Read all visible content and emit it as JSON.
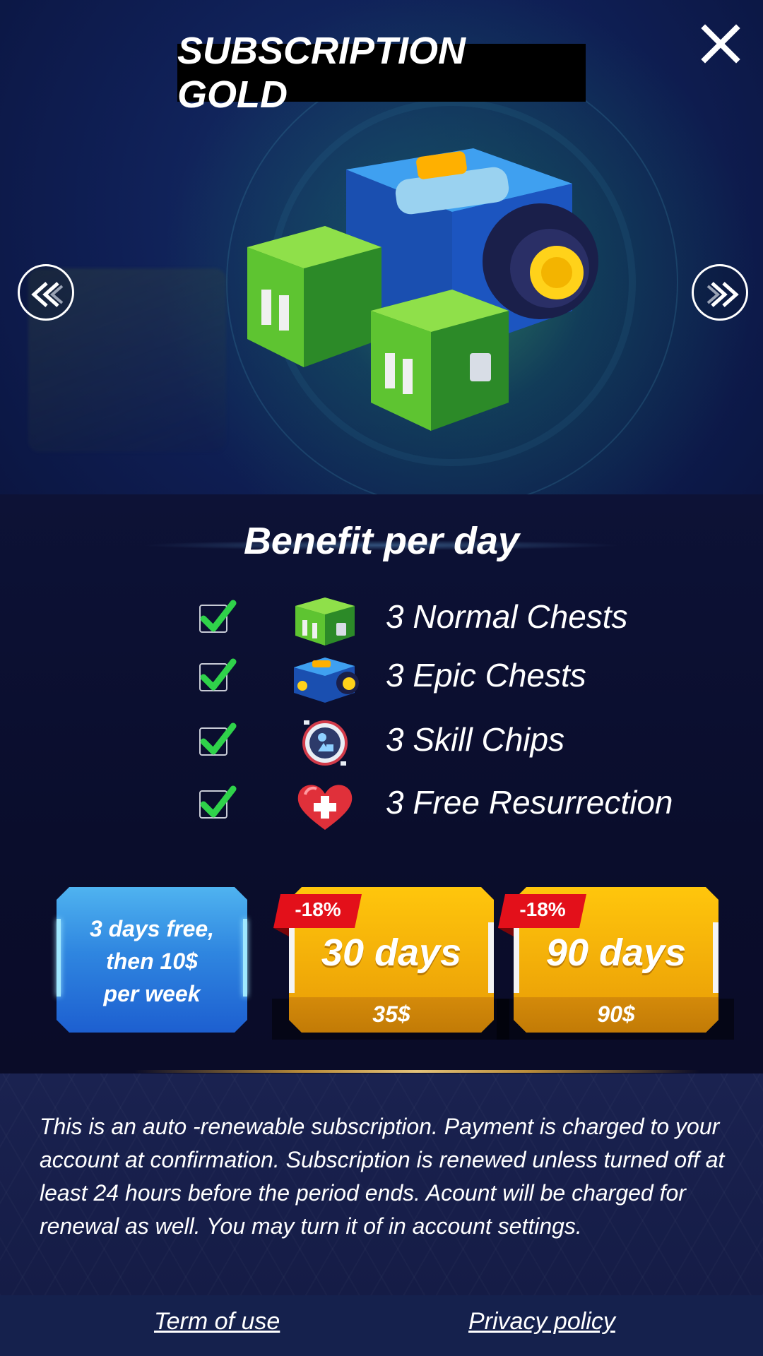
{
  "header": {
    "title": "SUBSCRIPTION GOLD",
    "close_icon": "close-icon",
    "prev_icon": "double-chevron-left-icon",
    "next_icon": "double-chevron-right-icon"
  },
  "hero": {
    "image": "chest-bundle-image"
  },
  "benefits": {
    "title": "Benefit per day",
    "items": [
      {
        "label": "3 Normal Chests",
        "icon": "normal-chest-icon",
        "checked": true
      },
      {
        "label": "3 Epic Chests",
        "icon": "epic-chest-icon",
        "checked": true
      },
      {
        "label": "3 Skill Chips",
        "icon": "skill-chip-icon",
        "checked": true
      },
      {
        "label": "3 Free Resurrection",
        "icon": "heart-plus-icon",
        "checked": true
      }
    ]
  },
  "offers": {
    "free_trial": {
      "line1": "3 days free,",
      "line2": "then 10$",
      "line3": "per week"
    },
    "plan_30": {
      "discount": "-18%",
      "duration": "30 days",
      "price": "35$"
    },
    "plan_90": {
      "discount": "-18%",
      "duration": "90 days",
      "price": "90$"
    }
  },
  "disclaimer": "This is an auto -renewable subscription. Payment is charged to your account at confirmation. Subscription is renewed unless turned off at least 24 hours before the period ends. Acount will be charged for renewal as well. You may turn it of in account settings.",
  "footer": {
    "terms": "Term of use",
    "privacy": "Privacy policy"
  },
  "colors": {
    "background": "#0b0f2e",
    "gold": "#f6b40a",
    "blue_offer": "#2f86e0",
    "discount_red": "#e3101a",
    "check_green": "#2fd24a"
  }
}
